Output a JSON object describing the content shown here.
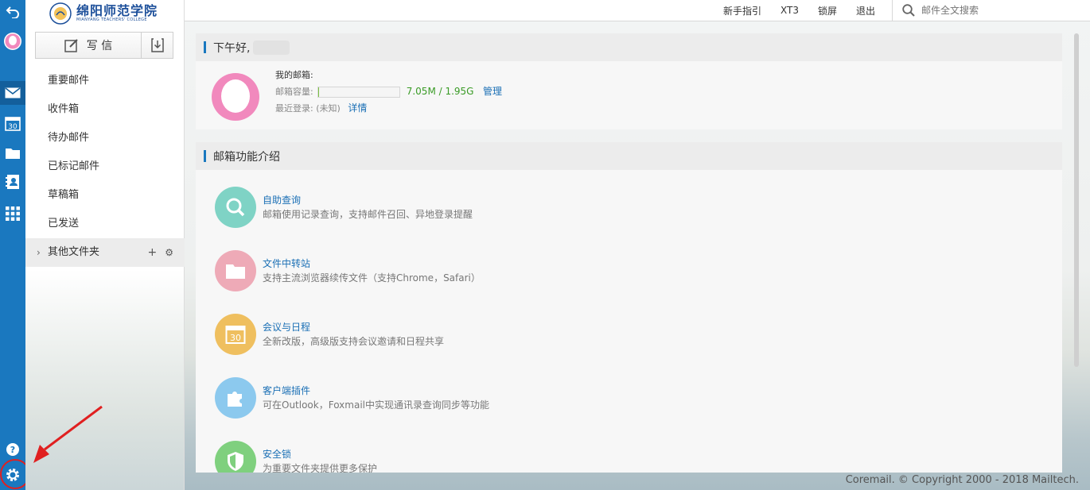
{
  "topbar": {
    "links": [
      "新手指引",
      "XT3",
      "锁屏",
      "退出"
    ],
    "search_placeholder": "邮件全文搜索"
  },
  "logo": {
    "text": "绵阳师范学院",
    "sub": "MIANYANG TEACHERS' COLLEGE"
  },
  "sidebar": {
    "compose_label": "写 信",
    "folders": [
      "重要邮件",
      "收件箱",
      "待办邮件",
      "已标记邮件",
      "草稿箱",
      "已发送"
    ],
    "other_folders_label": "其他文件夹"
  },
  "rail": {
    "icons": [
      "back-icon",
      "avatar-icon",
      "mail-icon",
      "calendar-icon",
      "folder-icon",
      "contacts-icon",
      "apps-icon",
      "help-icon",
      "settings-icon"
    ],
    "calendar_day": "30"
  },
  "greeting": {
    "text": "下午好,",
    "mailbox_title": "我的邮箱:",
    "quota_label": "邮箱容量:",
    "quota_value": "7.05M / 1.95G",
    "quota_fraction": 0.0035,
    "manage_link": "管理",
    "last_login_label": "最近登录:",
    "last_login_value": "(未知)",
    "detail_link": "详情"
  },
  "features": {
    "title": "邮箱功能介绍",
    "items": [
      {
        "title": "自助查询",
        "desc": "邮箱使用记录查询，支持邮件召回、异地登录提醒",
        "icon": "search-icon",
        "color": "#7fd3c5"
      },
      {
        "title": "文件中转站",
        "desc": "支持主流浏览器续传文件（支持Chrome，Safari）",
        "icon": "folder-icon",
        "color": "#eeaab7"
      },
      {
        "title": "会议与日程",
        "desc": "全新改版，高级版支持会议邀请和日程共享",
        "icon": "calendar-icon",
        "color": "#efbf5f",
        "badge": "30"
      },
      {
        "title": "客户端插件",
        "desc": "可在Outlook，Foxmail中实现通讯录查询同步等功能",
        "icon": "puzzle-icon",
        "color": "#8cc9ee"
      },
      {
        "title": "安全锁",
        "desc": "为重要文件夹提供更多保护",
        "icon": "shield-icon",
        "color": "#7fd07e"
      }
    ]
  },
  "footer": "Coremail. © Copyright 2000 - 2018 Mailtech."
}
